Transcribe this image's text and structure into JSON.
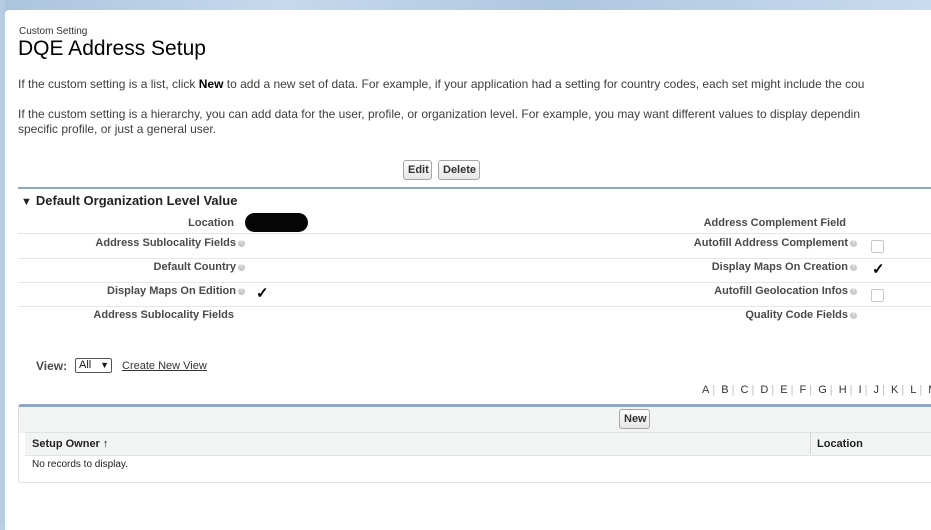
{
  "header": {
    "breadcrumb": "Custom Setting",
    "title": "DQE Address Setup"
  },
  "description": {
    "line1_pre": "If the custom setting is a list, click ",
    "line1_bold": "New",
    "line1_post": " to add a new set of data. For example, if your application had a setting for country codes, each set might include the cou",
    "line2a": "If the custom setting is a hierarchy, you can add data for the user, profile, or organization level. For example, you may want different values to display dependin",
    "line2b": "specific profile, or just a general user."
  },
  "buttons": {
    "edit": "Edit",
    "delete": "Delete",
    "new": "New"
  },
  "section": {
    "title": "Default Organization Level Value",
    "left_fields": [
      {
        "label": "Location",
        "value": "redacted"
      },
      {
        "label": "Address Sublocality Fields",
        "value": ""
      },
      {
        "label": "Default Country",
        "value": ""
      },
      {
        "label": "Display Maps On Edition",
        "value": "checked"
      },
      {
        "label": "Address Sublocality Fields",
        "value": ""
      }
    ],
    "right_fields": [
      {
        "label": "Address Complement Field",
        "value": ""
      },
      {
        "label": "Autofill Address Complement",
        "value": "unchecked"
      },
      {
        "label": "Display Maps On Creation",
        "value": "checked"
      },
      {
        "label": "Autofill Geolocation Infos",
        "value": "unchecked"
      },
      {
        "label": "Quality Code Fields",
        "value": ""
      }
    ],
    "check_glyph": "✓"
  },
  "view": {
    "label": "View:",
    "selected": "All",
    "create_link": "Create New View"
  },
  "alphabet": [
    "A",
    "B",
    "C",
    "D",
    "E",
    "F",
    "G",
    "H",
    "I",
    "J",
    "K",
    "L",
    "M"
  ],
  "list": {
    "columns": [
      {
        "label": "Setup Owner ↑"
      },
      {
        "label": "Location"
      }
    ],
    "empty_text": "No records to display."
  },
  "colors": {
    "section_rule": "#8fa7bf",
    "background_band": "#b8cfe4"
  },
  "icons": {
    "help": "help-icon",
    "collapse": "triangle-down-icon",
    "dropdown": "chevron-down-icon"
  }
}
